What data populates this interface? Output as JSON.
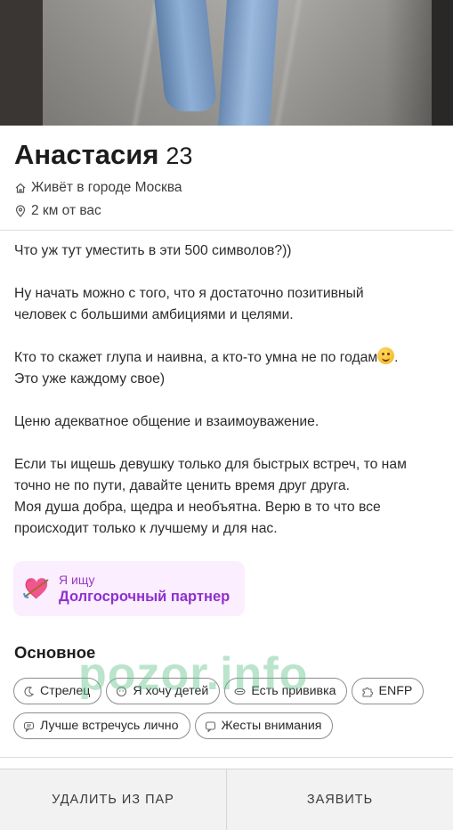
{
  "profile": {
    "name": "Анастасия",
    "age": "23",
    "city": "Живёт в городе Москва",
    "distance": "2 км от вас"
  },
  "bio": {
    "p1": "Что уж тут уместить в эти 500 символов?))",
    "p2a": "Ну начать можно с того, что я достаточно позитивный",
    "p2b": "человек с большими амбициями и целями.",
    "p3a": "Кто то скажет глупа и наивна, а кто-то умна не по годам",
    "p3a_end": ".",
    "p3b": "Это уже каждому свое)",
    "p4": "Ценю адекватное общение и взаимоуважение.",
    "p5a": "Если ты ищешь девушку только для быстрых встреч, то нам",
    "p5b": "точно не по пути, давайте ценить время друг друга.",
    "p5c": "Моя душа добра, щедра и необъятна. Верю в то что все",
    "p5d": "происходит только к лучшему и для нас."
  },
  "looking_for": {
    "label": "Я ищу",
    "value": "Долгосрочный партнер",
    "icon": "heart-arrow-icon"
  },
  "basics": {
    "title": "Основное",
    "chips": [
      {
        "label": "Стрелец",
        "icon": "moon-icon"
      },
      {
        "label": "Я хочу детей",
        "icon": "baby-icon"
      },
      {
        "label": "Есть прививка",
        "icon": "vaccine-icon"
      },
      {
        "label": "ENFP",
        "icon": "puzzle-icon"
      },
      {
        "label": "Лучше встречусь лично",
        "icon": "chat-icon"
      },
      {
        "label": "Жесты внимания",
        "icon": "message-icon"
      }
    ]
  },
  "watermark": "pozor.info",
  "actions": {
    "remove": "УДАЛИТЬ ИЗ ПАР",
    "report": "ЗАЯВИТЬ"
  },
  "colors": {
    "accent_purple": "#8f2fcf",
    "looking_bg": "#fbeefe",
    "watermark": "#5abe82"
  }
}
